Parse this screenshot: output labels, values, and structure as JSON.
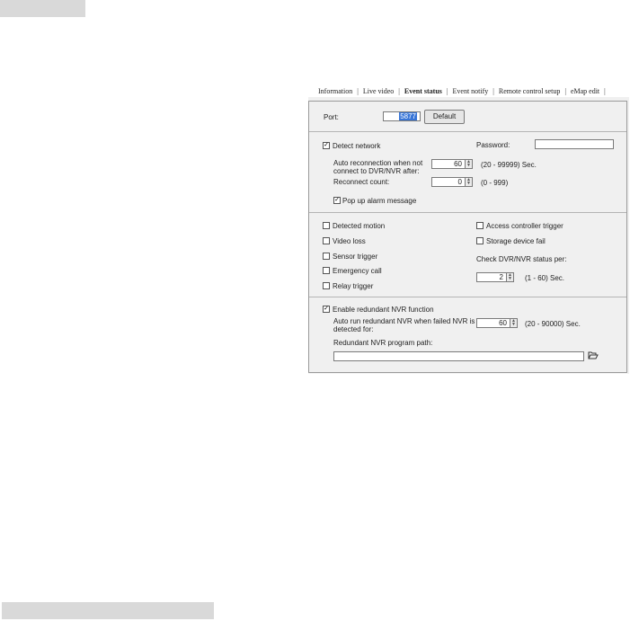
{
  "tabs": [
    {
      "label": "Information",
      "active": false
    },
    {
      "label": "Live video",
      "active": false
    },
    {
      "label": "Event status",
      "active": true
    },
    {
      "label": "Event notify",
      "active": false
    },
    {
      "label": "Remote control setup",
      "active": false
    },
    {
      "label": "eMap edit",
      "active": false
    }
  ],
  "port": {
    "label": "Port:",
    "value": "5877",
    "default_button": "Default"
  },
  "network": {
    "detect_label": "Detect network",
    "detect_checked": true,
    "password_label": "Password:",
    "password_value": "",
    "auto_reconnect_label_1": "Auto reconnection when not",
    "auto_reconnect_label_2": "connect to DVR/NVR after:",
    "auto_reconnect_value": "60",
    "auto_reconnect_range": "(20 - 99999) Sec.",
    "reconnect_count_label": "Reconnect count:",
    "reconnect_count_value": "0",
    "reconnect_count_range": "(0 - 999)",
    "popup_label": "Pop up alarm message",
    "popup_checked": true
  },
  "events": {
    "left": [
      {
        "label": "Detected motion",
        "checked": false
      },
      {
        "label": "Video loss",
        "checked": false
      },
      {
        "label": "Sensor trigger",
        "checked": false
      },
      {
        "label": "Emergency call",
        "checked": false
      },
      {
        "label": "Relay trigger",
        "checked": false
      }
    ],
    "right": [
      {
        "label": "Access controller trigger",
        "checked": false
      },
      {
        "label": "Storage device fail",
        "checked": false
      }
    ],
    "check_status_label": "Check DVR/NVR status per:",
    "check_status_value": "2",
    "check_status_range": "(1 - 60) Sec."
  },
  "redundant": {
    "enable_label": "Enable redundant NVR function",
    "enable_checked": true,
    "auto_run_label_1": "Auto run redundant NVR when failed NVR is",
    "auto_run_label_2": "detected for:",
    "auto_run_value": "60",
    "auto_run_range": "(20 - 90000) Sec.",
    "path_label": "Redundant NVR program path:",
    "path_value": ""
  },
  "icons": {
    "spin": "spin-arrows-icon",
    "folder": "folder-open-icon"
  }
}
